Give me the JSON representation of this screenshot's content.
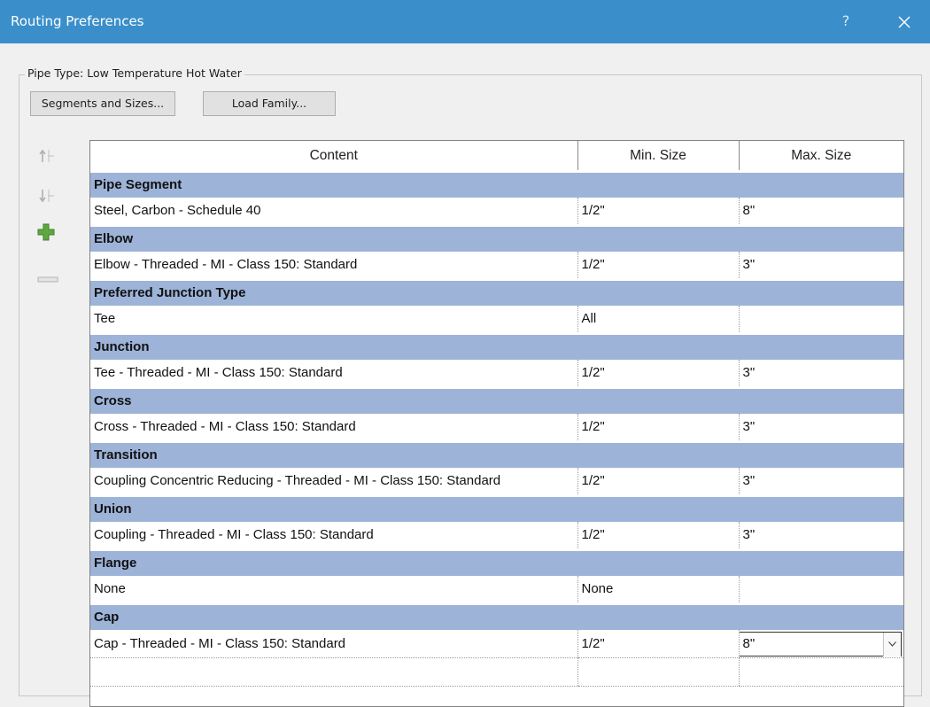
{
  "window": {
    "title": "Routing Preferences",
    "help_label": "?"
  },
  "pipe_type": {
    "label": "Pipe Type: Low Temperature Hot Water"
  },
  "buttons": {
    "segments_sizes": "Segments and Sizes...",
    "load_family": "Load Family..."
  },
  "sidebar": {
    "icons": [
      "move-up-icon",
      "move-down-icon",
      "add-row-icon",
      "remove-row-icon"
    ],
    "add_color": "#5fa83f"
  },
  "grid": {
    "headers": [
      "Content",
      "Min. Size",
      "Max. Size"
    ],
    "sections": [
      {
        "category": "Pipe Segment",
        "content": "Steel, Carbon - Schedule 40",
        "min": "1/2\"",
        "max": "8\""
      },
      {
        "category": "Elbow",
        "content": "Elbow - Threaded - MI - Class 150: Standard",
        "min": "1/2\"",
        "max": "3\""
      },
      {
        "category": "Preferred Junction Type",
        "content": "Tee",
        "min": "All",
        "max": ""
      },
      {
        "category": "Junction",
        "content": "Tee - Threaded - MI - Class 150: Standard",
        "min": "1/2\"",
        "max": "3\""
      },
      {
        "category": "Cross",
        "content": "Cross - Threaded - MI - Class 150: Standard",
        "min": "1/2\"",
        "max": "3\""
      },
      {
        "category": "Transition",
        "content": "Coupling Concentric Reducing - Threaded - MI - Class 150: Standard",
        "min": "1/2\"",
        "max": "3\""
      },
      {
        "category": "Union",
        "content": "Coupling - Threaded - MI - Class 150: Standard",
        "min": "1/2\"",
        "max": "3\""
      },
      {
        "category": "Flange",
        "content": "None",
        "min": "None",
        "max": ""
      },
      {
        "category": "Cap",
        "content": "Cap - Threaded - MI - Class 150: Standard",
        "min": "1/2\"",
        "max": "8\""
      }
    ],
    "selected_cell": {
      "section": 8,
      "column": "max",
      "value": "8\""
    },
    "category_color": "#9db3d8"
  },
  "colors": {
    "titlebar": "#3a8fca",
    "background": "#f0f0f0"
  }
}
